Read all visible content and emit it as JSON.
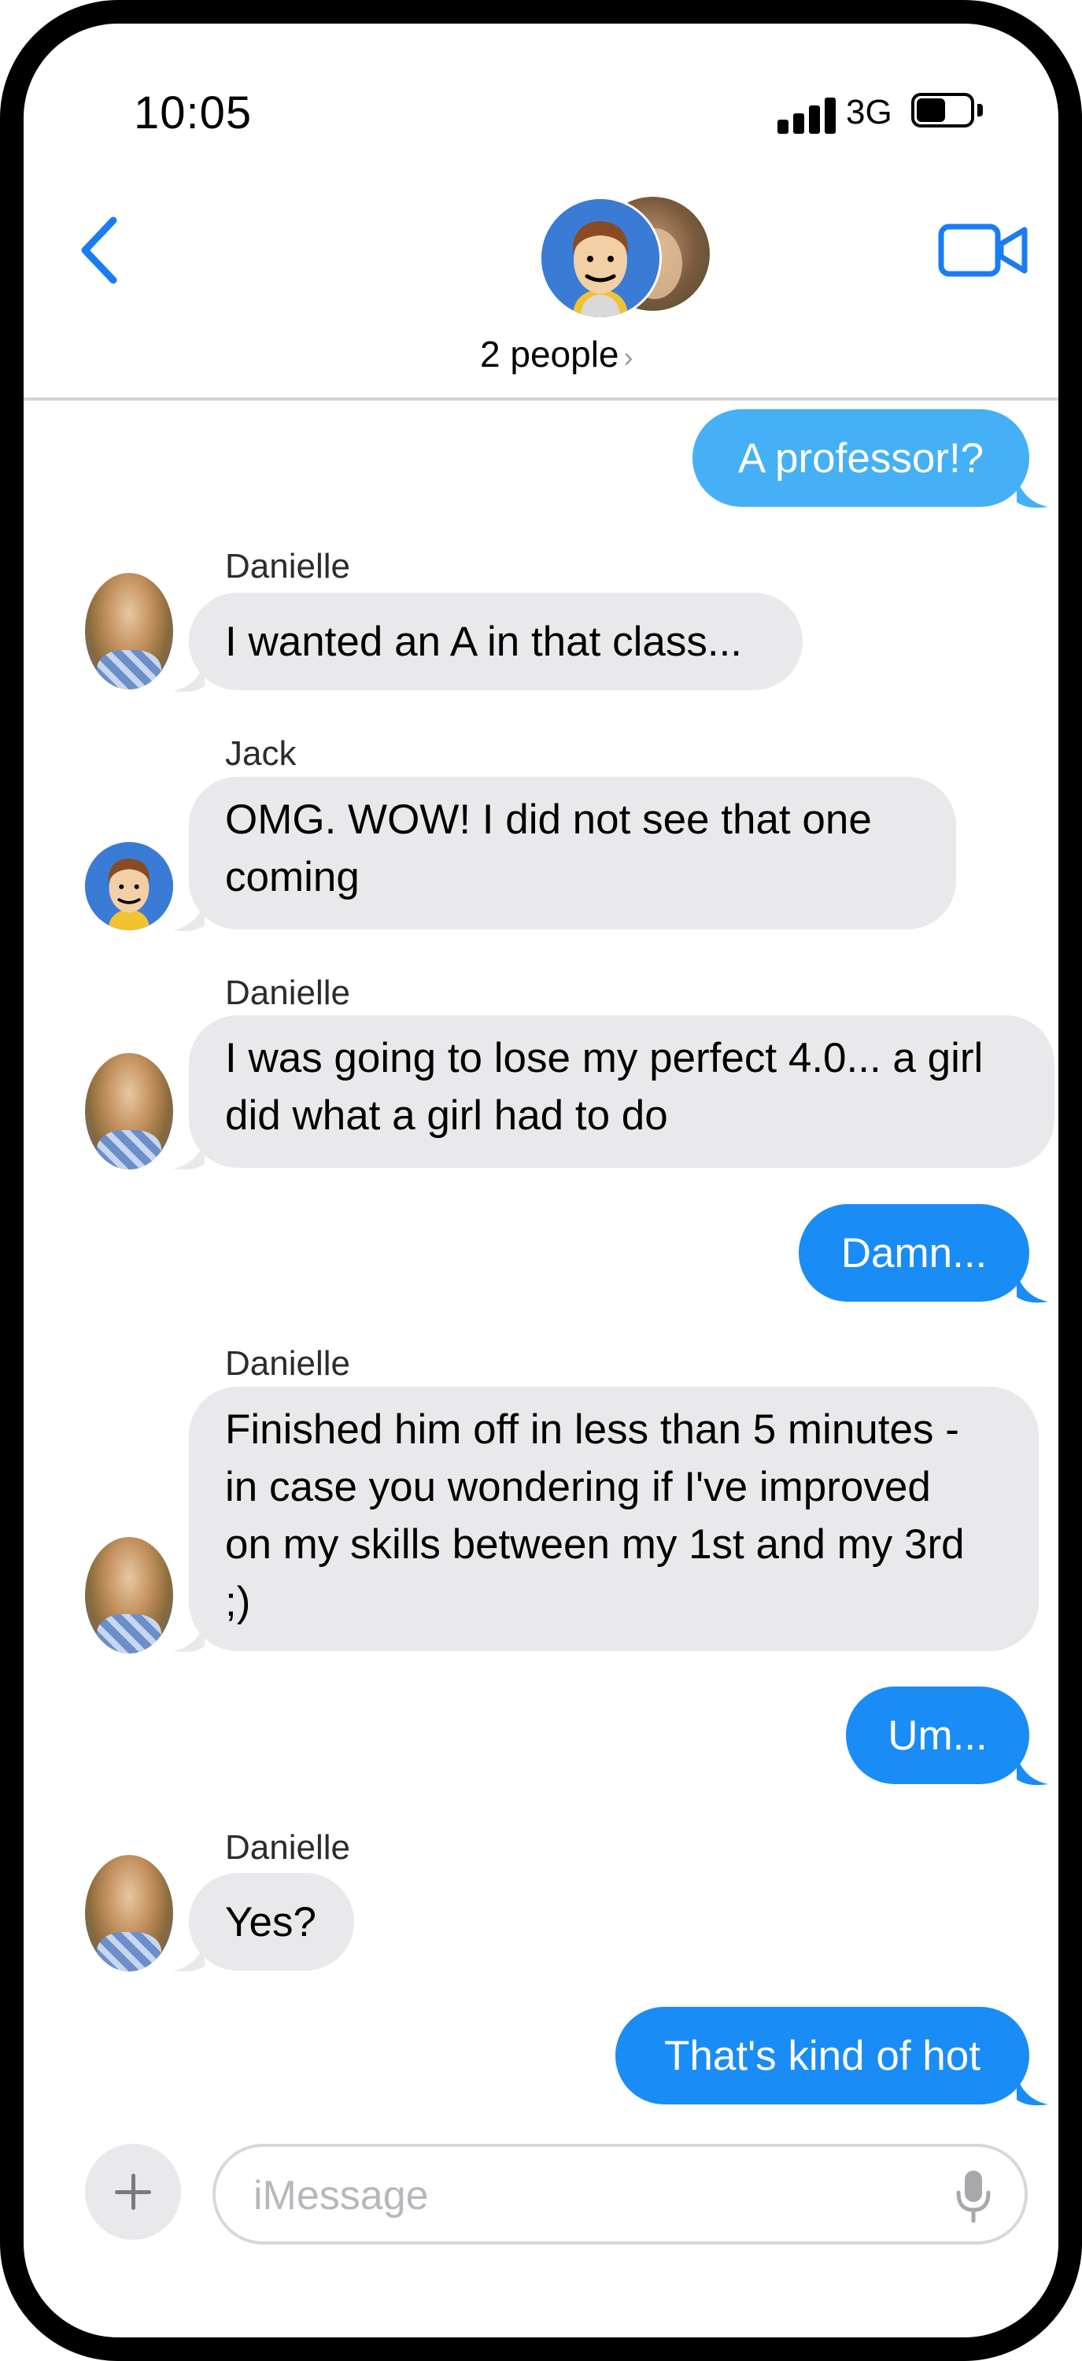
{
  "status_bar": {
    "time": "10:05",
    "network": "3G"
  },
  "header": {
    "title": "2 people",
    "chevron": "›",
    "back_icon": "chevron-left-icon",
    "video_icon": "video-camera-icon"
  },
  "colors": {
    "accent": "#1a7cf5",
    "outgoing_bubble": "#1a8cf5",
    "outgoing_bubble_light": "#45b0f5",
    "incoming_bubble": "#e9e9eb"
  },
  "messages": [
    {
      "direction": "out",
      "text": "A professor!?"
    },
    {
      "direction": "in",
      "sender": "Danielle",
      "text": "I wanted an A in that class..."
    },
    {
      "direction": "in",
      "sender": "Jack",
      "text_lines": [
        "OMG.  WOW!  I did not see that one",
        "coming"
      ]
    },
    {
      "direction": "in",
      "sender": "Danielle",
      "text_lines": [
        "I was going to lose my perfect 4.0... a girl",
        "did what a girl had to do"
      ]
    },
    {
      "direction": "out",
      "text": "Damn..."
    },
    {
      "direction": "in",
      "sender": "Danielle",
      "text_lines": [
        "Finished him off in less than 5 minutes -",
        "in case you wondering if I've improved",
        "on my skills between my 1st and my 3rd",
        ";)"
      ]
    },
    {
      "direction": "out",
      "text": "Um..."
    },
    {
      "direction": "in",
      "sender": "Danielle",
      "text": "Yes?"
    },
    {
      "direction": "out",
      "text": "That's kind of hot"
    }
  ],
  "composer": {
    "placeholder": "iMessage",
    "value": ""
  }
}
